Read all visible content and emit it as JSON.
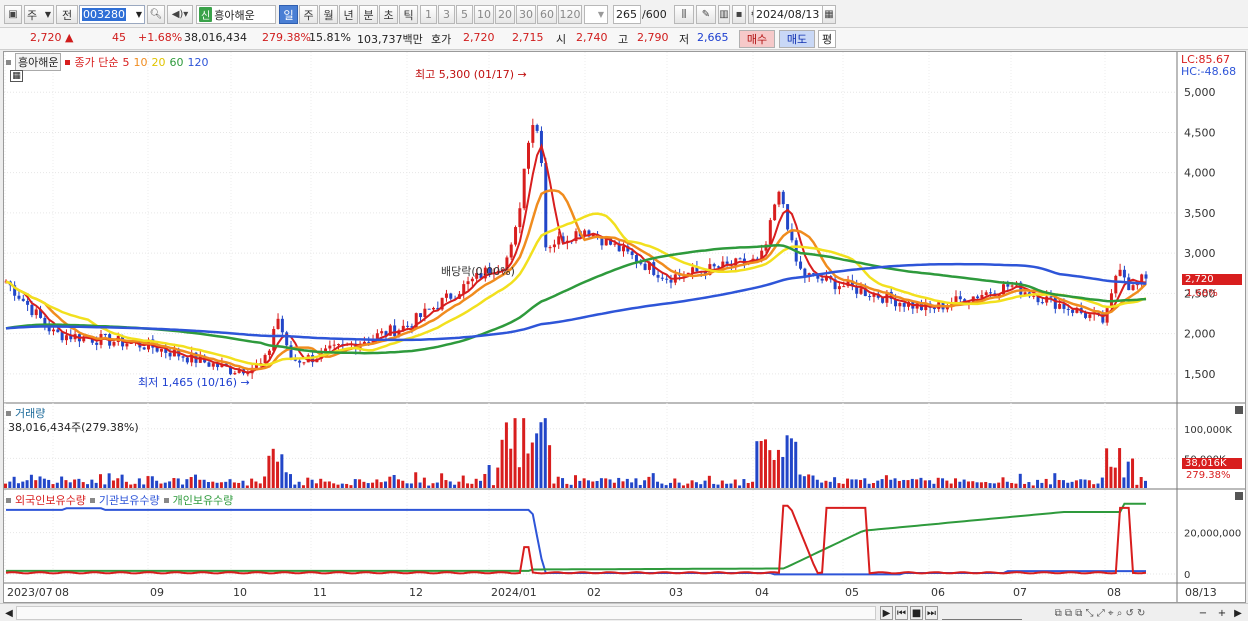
{
  "toolbar": {
    "period_type": "주",
    "prev_label": "전",
    "stock_code": "003280",
    "stock_name": "흥아해운",
    "new_badge": "신",
    "periods": [
      "일",
      "주",
      "월",
      "년",
      "분",
      "초",
      "틱"
    ],
    "active_period": "일",
    "minute_options": [
      "1",
      "3",
      "5",
      "10",
      "20",
      "30",
      "60",
      "120"
    ],
    "count_display": "265",
    "count_total": "/600",
    "date": "2024/08/13"
  },
  "quote": {
    "price": "2,720",
    "change": "45",
    "change_pct": "+1.68%",
    "volume": "38,016,434",
    "volume_ratio": "279.38%",
    "turnover": "15.81%",
    "amount": "103,737백만",
    "hoga_label": "호가",
    "ask": "2,720",
    "bid": "2,715",
    "open_label": "시",
    "open": "2,740",
    "high_label": "고",
    "high": "2,790",
    "low_label": "저",
    "low": "2,665",
    "buy_label": "매수",
    "sell_label": "매도",
    "eval_label": "평"
  },
  "price_pane": {
    "stock_tag": "흥아해운",
    "legend_label": "종가 단순",
    "ma_periods": [
      "5",
      "10",
      "20",
      "60",
      "120"
    ],
    "ma_colors": [
      "#d81e1e",
      "#f08c1e",
      "#f2e01e",
      "#2e9a3c",
      "#2e55d8"
    ],
    "lc_label": "LC:85.67",
    "hc_label": "HC:-48.68",
    "high_annotation": "최고 5,300 (01/17)",
    "low_annotation": "최저 1,465 (10/16)",
    "dividend_annotation": "배당락(0.00%)",
    "current_price_box": "2,720",
    "current_pct": "1.68%",
    "y_ticks": [
      "5,000",
      "4,500",
      "4,000",
      "3,500",
      "3,000",
      "2,500",
      "2,000",
      "1,500"
    ]
  },
  "volume_pane": {
    "title": "거래량",
    "summary": "38,016,434주(279.38%)",
    "y_ticks": [
      "100,000K",
      "50,000K"
    ],
    "current_box": "38,016K",
    "current_pct": "279.38%"
  },
  "holding_pane": {
    "legend": [
      "외국인보유수량",
      "기관보유수량",
      "개인보유수량"
    ],
    "colors": [
      "#d81e1e",
      "#2e55d8",
      "#2e9a3c"
    ],
    "y_ticks": [
      "20,000,000",
      "0"
    ]
  },
  "x_axis": {
    "labels": [
      "2023/07",
      "08",
      "09",
      "10",
      "11",
      "12",
      "2024/01",
      "02",
      "03",
      "04",
      "05",
      "06",
      "07",
      "08"
    ],
    "end_label": "08/13"
  },
  "chart_data": {
    "type": "line",
    "title": "흥아해운 (003280) 일봉",
    "price_range": [
      1300,
      5400
    ],
    "close_series": {
      "name": "종가",
      "x": [
        "2023/07",
        "08",
        "09",
        "10",
        "11",
        "12",
        "2024/01",
        "02",
        "03",
        "04",
        "05",
        "06",
        "07",
        "08",
        "08/13"
      ],
      "values": [
        2650,
        2000,
        1850,
        1550,
        1700,
        2100,
        2800,
        3300,
        2700,
        2900,
        2600,
        2300,
        2600,
        2150,
        2720
      ]
    },
    "annotations": {
      "max": {
        "date": "2024/01/17",
        "value": 5300
      },
      "min": {
        "date": "2023/10/16",
        "value": 1465
      }
    }
  }
}
